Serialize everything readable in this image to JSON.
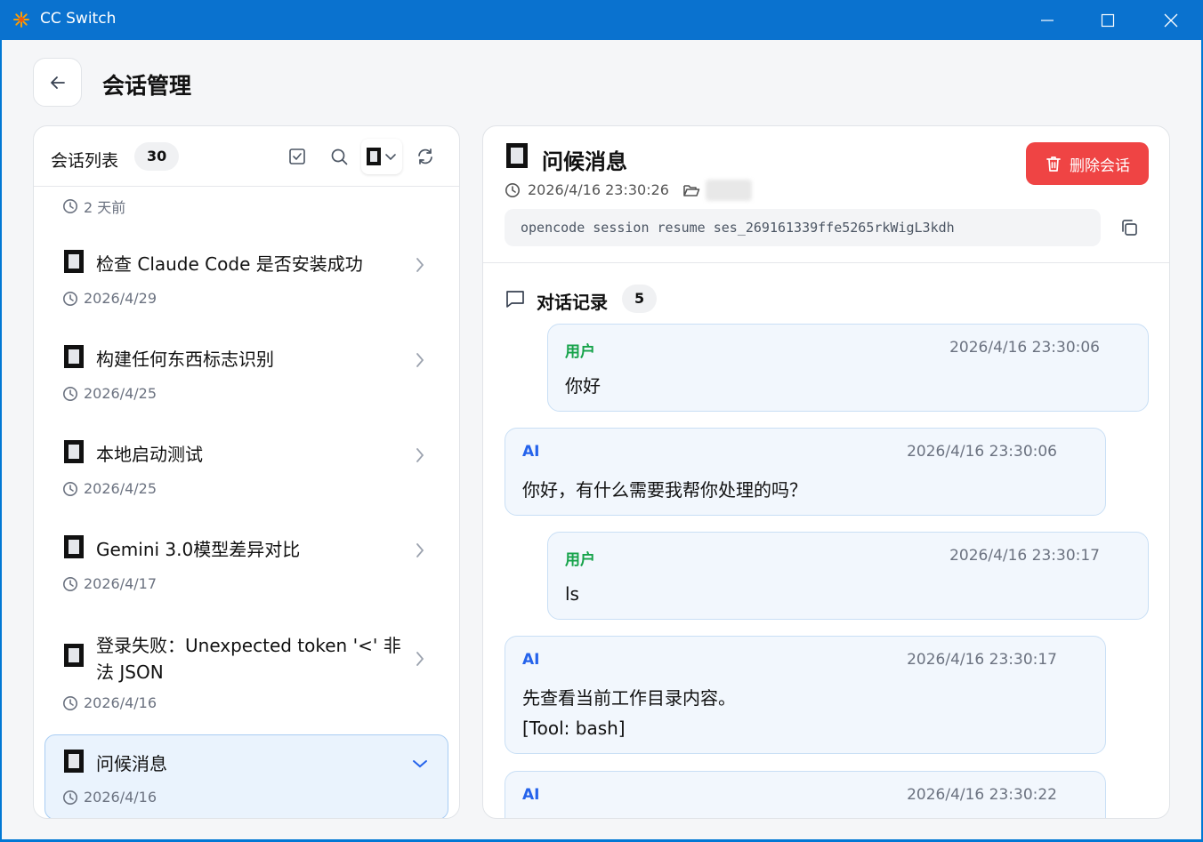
{
  "window": {
    "title": "CC Switch"
  },
  "page": {
    "title": "会话管理"
  },
  "list": {
    "title": "会话列表",
    "count": "30",
    "items": [
      {
        "title": "",
        "time": "2 天前"
      },
      {
        "title": "检查 Claude Code 是否安装成功",
        "time": "2026/4/29"
      },
      {
        "title": "构建任何东西标志识别",
        "time": "2026/4/25"
      },
      {
        "title": "本地启动测试",
        "time": "2026/4/25"
      },
      {
        "title": "Gemini 3.0模型差异对比",
        "time": "2026/4/17"
      },
      {
        "title": "登录失败：Unexpected token '<' 非法 JSON",
        "time": "2026/4/16"
      },
      {
        "title": "问候消息",
        "time": "2026/4/16"
      }
    ]
  },
  "detail": {
    "title": "问候消息",
    "delete_label": "删除会话",
    "timestamp": "2026/4/16 23:30:26",
    "command": "opencode session resume ses_269161339ffe5265rkWigL3kdh",
    "conversation_title": "对话记录",
    "conversation_count": "5",
    "messages": [
      {
        "role": "用户",
        "time": "2026/4/16 23:30:06",
        "text": "你好"
      },
      {
        "role": "AI",
        "time": "2026/4/16 23:30:06",
        "text": "你好，有什么需要我帮你处理的吗？"
      },
      {
        "role": "用户",
        "time": "2026/4/16 23:30:17",
        "text": "ls"
      },
      {
        "role": "AI",
        "time": "2026/4/16 23:30:17",
        "text": "先查看当前工作目录内容。\n[Tool: bash]"
      },
      {
        "role": "AI",
        "time": "2026/4/16 23:30:22",
        "text": ""
      }
    ]
  },
  "colors": {
    "titlebar": "#0a72cf",
    "accent": "#2563eb",
    "user_role": "#16a34a",
    "danger": "#ef4444"
  }
}
